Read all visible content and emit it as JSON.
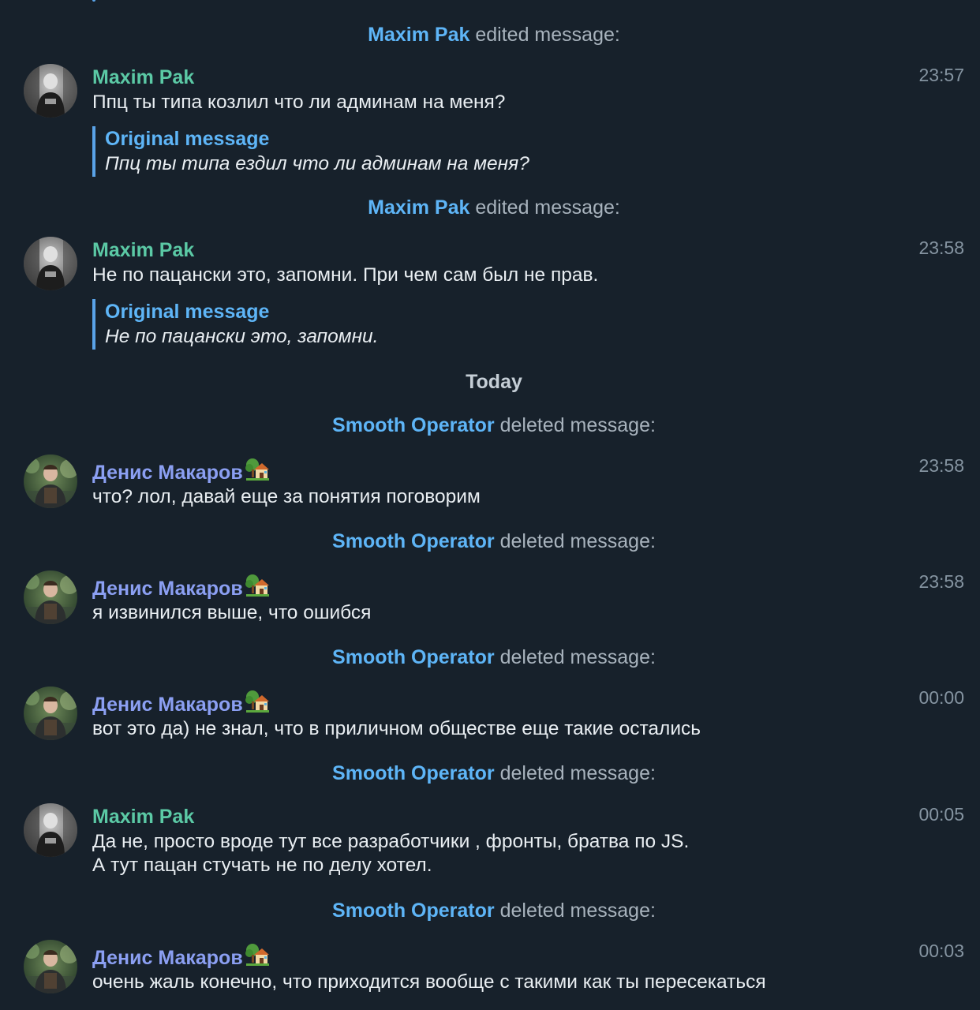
{
  "colors": {
    "background": "#17212b",
    "actor": "#5eb5f7",
    "sender_maxim": "#5bc9a5",
    "sender_denis": "#8b9ff2",
    "muted": "#a8b3bd",
    "quote_bar": "#5aa3e8"
  },
  "events": {
    "e1": {
      "actor": "Maxim Pak",
      "action": "edited message:"
    },
    "e2": {
      "actor": "Maxim Pak",
      "action": "edited message:"
    },
    "e3": {
      "actor": "Smooth Operator",
      "action": "deleted message:"
    },
    "e4": {
      "actor": "Smooth Operator",
      "action": "deleted message:"
    },
    "e5": {
      "actor": "Smooth Operator",
      "action": "deleted message:"
    },
    "e6": {
      "actor": "Smooth Operator",
      "action": "deleted message:"
    },
    "e7": {
      "actor": "Smooth Operator",
      "action": "deleted message:"
    }
  },
  "date_separator": "Today",
  "messages": {
    "m1": {
      "sender": "Maxim Pak",
      "time": "23:57",
      "text": "Ппц ты типа козлил что ли админам на меня?",
      "quote_title": "Original message",
      "quote_text": "Ппц ты типа ездил что ли админам на меня?",
      "avatar_icon": "avatar-maxim"
    },
    "m2": {
      "sender": "Maxim Pak",
      "time": "23:58",
      "text": "Не по пацански это, запомни. При чем сам был не прав.",
      "quote_title": "Original message",
      "quote_text": "Не по пацански это, запомни.",
      "avatar_icon": "avatar-maxim"
    },
    "m3": {
      "sender": "Денис Макаров",
      "time": "23:58",
      "text": "что? лол, давай еще за понятия поговорим",
      "avatar_icon": "avatar-denis",
      "emoji_icon": "house-with-garden-icon"
    },
    "m4": {
      "sender": "Денис Макаров",
      "time": "23:58",
      "text": "я извинился выше, что ошибся",
      "avatar_icon": "avatar-denis",
      "emoji_icon": "house-with-garden-icon"
    },
    "m5": {
      "sender": "Денис Макаров",
      "time": "00:00",
      "text": "вот это да) не знал, что в приличном обществе еще такие остались",
      "avatar_icon": "avatar-denis",
      "emoji_icon": "house-with-garden-icon"
    },
    "m6": {
      "sender": "Maxim Pak",
      "time": "00:05",
      "text_line1": "Да не, просто вроде тут все разработчики , фронты, братва по JS.",
      "text_line2": "А тут пацан стучать не по делу хотел.",
      "avatar_icon": "avatar-maxim"
    },
    "m7": {
      "sender": "Денис Макаров",
      "time": "00:03",
      "text": "очень жаль конечно, что приходится вообще с такими как ты пересекаться",
      "avatar_icon": "avatar-denis",
      "emoji_icon": "house-with-garden-icon"
    }
  }
}
